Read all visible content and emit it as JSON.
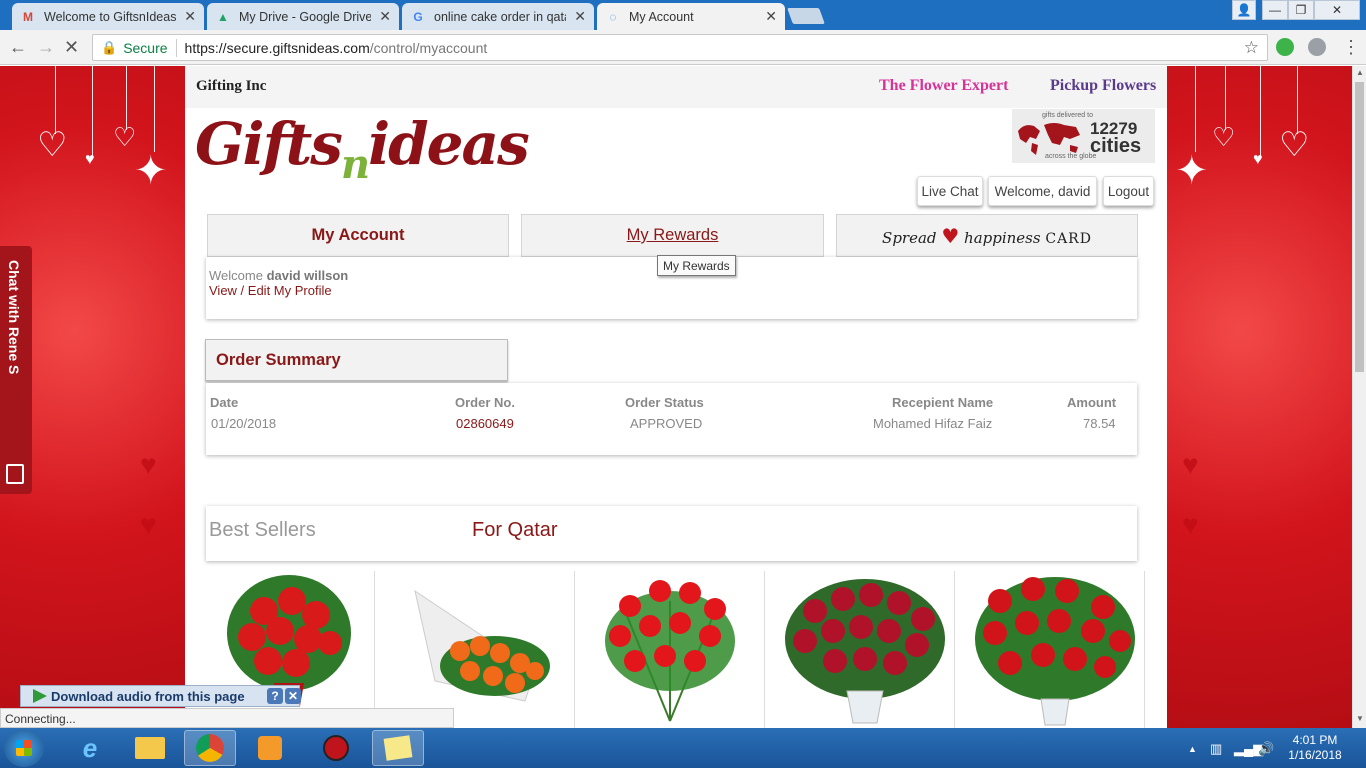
{
  "browser": {
    "tabs": [
      {
        "title": "Welcome to GiftsnIdeas",
        "favicon": "gmail-icon",
        "active": false
      },
      {
        "title": "My Drive - Google Drive",
        "favicon": "drive-icon",
        "active": false
      },
      {
        "title": "online cake order in qatar",
        "favicon": "google-icon",
        "active": false
      },
      {
        "title": "My Account",
        "favicon": "loading-icon",
        "active": true
      }
    ],
    "secure_label": "Secure",
    "url_host": "https://secure.giftsnideas.com",
    "url_path": "/control/myaccount"
  },
  "site": {
    "brand_name": "Gifting Inc",
    "flower_expert": "The Flower Expert",
    "pickup_flowers": "Pickup Flowers",
    "logo_part1": "Gifts",
    "logo_part2": "n",
    "logo_part3": "ideas",
    "cities": {
      "line1": "gifts delivered to",
      "count": "12279",
      "unit": "cities",
      "line2": "across the globe"
    },
    "live_chat": "Live Chat",
    "welcome_user": "Welcome, david",
    "logout": "Logout"
  },
  "account": {
    "tab_my_account": "My Account",
    "tab_my_rewards": "My Rewards",
    "spread_word1": "Spread",
    "spread_word2": "happiness",
    "spread_card": "CARD",
    "tooltip": "My Rewards",
    "welcome_prefix": "Welcome",
    "welcome_name": "david willson",
    "edit_profile": "View / Edit My Profile"
  },
  "orders": {
    "title": "Order Summary",
    "headers": {
      "date": "Date",
      "order_no": "Order No.",
      "status": "Order Status",
      "recipient": "Recepient Name",
      "amount": "Amount"
    },
    "rows": [
      {
        "date": "01/20/2018",
        "order_no": "02860649",
        "status": "APPROVED",
        "recipient": "Mohamed Hifaz Faiz",
        "amount": "78.54"
      }
    ]
  },
  "best_sellers": {
    "title": "Best Sellers",
    "region": "For Qatar"
  },
  "chat_tab": "Chat with Rene S",
  "download_bar": "Download audio from this page",
  "status_text": "Connecting...",
  "taskbar": {
    "time": "4:01 PM",
    "date": "1/16/2018"
  },
  "colors": {
    "accent": "#8a1818",
    "pink": "#d5339a",
    "purple": "#5a3a8a",
    "background_red": "#d91820"
  }
}
